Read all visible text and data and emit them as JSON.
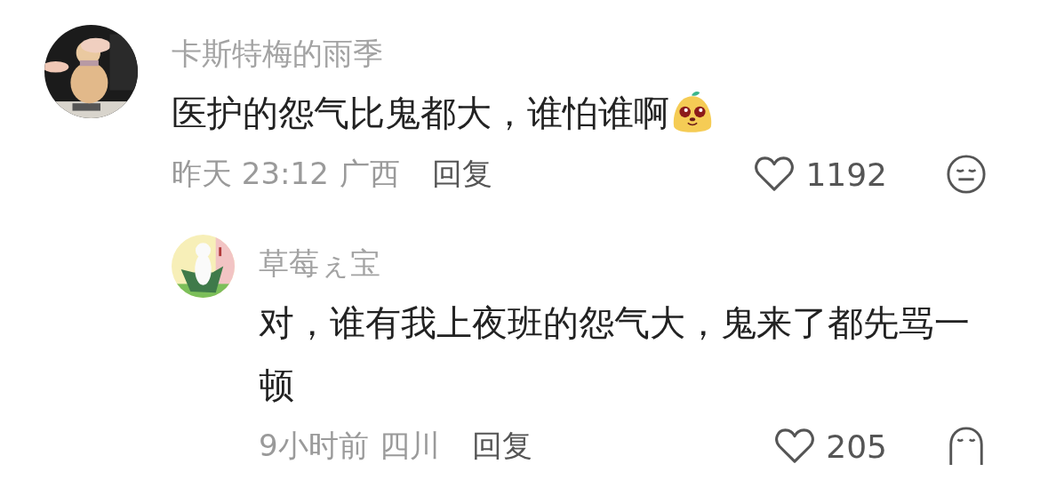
{
  "comments": [
    {
      "user": "卡斯特梅的雨季",
      "text": "医护的怨气比鬼都大，谁怕谁啊",
      "sticker": true,
      "time": "昨天 23:12",
      "location": "广西",
      "reply_label": "回复",
      "likes": "1192",
      "kind": "top",
      "children": [
        {
          "user": "草莓ぇ宝",
          "text": "对，谁有我上夜班的怨气大，鬼来了都先骂一顿",
          "sticker": false,
          "time": "9小时前",
          "location": "四川",
          "reply_label": "回复",
          "likes": "205",
          "kind": "reply"
        }
      ]
    }
  ]
}
